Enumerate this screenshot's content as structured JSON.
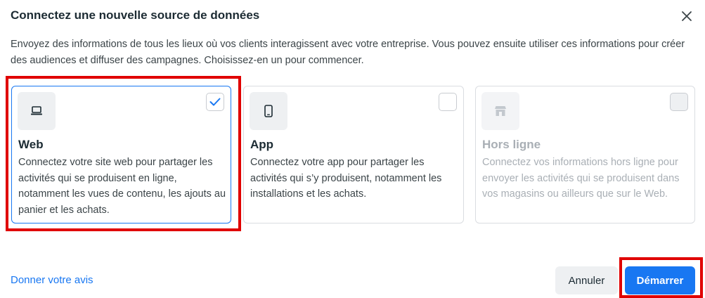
{
  "dialog": {
    "title": "Connectez une nouvelle source de données",
    "description": "Envoyez des informations de tous les lieux où vos clients interagissent avec votre entreprise. Vous pouvez ensuite utiliser ces informations pour créer des audiences et diffuser des campagnes. Choisissez-en un pour commencer."
  },
  "cards": [
    {
      "title": "Web",
      "description": "Connectez votre site web pour partager les activités qui se produisent en ligne, notamment les vues de contenu, les ajouts au panier et les achats.",
      "icon": "laptop-icon",
      "selected": true,
      "disabled": false
    },
    {
      "title": "App",
      "description": "Connectez votre app pour partager les activités qui s’y produisent, notamment les installations et les achats.",
      "icon": "phone-icon",
      "selected": false,
      "disabled": false
    },
    {
      "title": "Hors ligne",
      "description": "Connectez vos informations hors ligne pour envoyer les activités qui se produisent dans vos magasins ou ailleurs que sur le Web.",
      "icon": "store-icon",
      "selected": false,
      "disabled": true
    }
  ],
  "footer": {
    "feedback_link": "Donner votre avis",
    "cancel_label": "Annuler",
    "start_label": "Démarrer"
  },
  "colors": {
    "accent": "#1877f2",
    "highlight": "#e00000"
  }
}
